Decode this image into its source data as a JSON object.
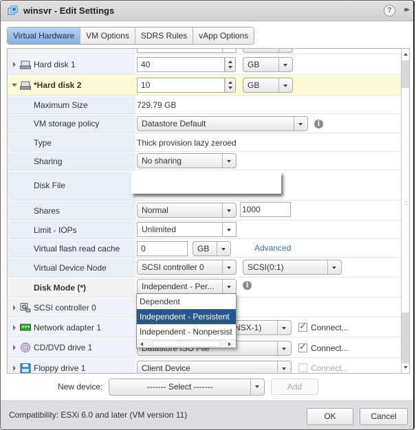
{
  "window": {
    "title": "winsvr - Edit Settings",
    "help_label": "?",
    "expand_label": "▸▸"
  },
  "tabs": [
    {
      "label": "Virtual Hardware",
      "active": true
    },
    {
      "label": "VM Options",
      "active": false
    },
    {
      "label": "SDRS Rules",
      "active": false
    },
    {
      "label": "vApp Options",
      "active": false
    }
  ],
  "hardware": {
    "hard_disk_1": {
      "label": "Hard disk 1",
      "size": "40",
      "unit": "GB"
    },
    "hard_disk_2": {
      "label": "*Hard disk 2",
      "size": "10",
      "unit": "GB",
      "max_size_label": "Maximum Size",
      "max_size_value": "729.79 GB",
      "storage_policy_label": "VM storage policy",
      "storage_policy_value": "Datastore Default",
      "type_label": "Type",
      "type_value": "Thick provision lazy zeroed",
      "sharing_label": "Sharing",
      "sharing_value": "No sharing",
      "disk_file_label": "Disk File",
      "shares_label": "Shares",
      "shares_value": "Normal",
      "shares_number": "1000",
      "limit_label": "Limit - IOPs",
      "limit_value": "Unlimited",
      "flash_label": "Virtual flash read cache",
      "flash_value": "0",
      "flash_unit": "GB",
      "advanced_link": "Advanced",
      "vdn_label": "Virtual Device Node",
      "vdn_controller": "SCSI controller 0",
      "vdn_slot": "SCSI(0:1)",
      "disk_mode_label": "Disk Mode (*)",
      "disk_mode_value": "Independent - Per..."
    },
    "scsi_controller": {
      "label": "SCSI controller 0"
    },
    "network_adapter": {
      "label": "Network adapter 1",
      "value": "NSX-1)",
      "connect_label": "Connect...",
      "connected": true
    },
    "cd_dvd": {
      "label": "CD/DVD drive 1",
      "value": "Datastore ISO File",
      "connect_label": "Connect...",
      "connected": true
    },
    "floppy": {
      "label": "Floppy drive 1",
      "value": "Client Device",
      "connect_label": "Connect...",
      "connected": false
    }
  },
  "disk_mode_dropdown": {
    "options": [
      "Dependent",
      "Independent - Persistent",
      "Independent - Nonpersist"
    ],
    "selected_index": 1
  },
  "new_device": {
    "label": "New device:",
    "select_value": "------- Select -------",
    "add_label": "Add"
  },
  "footer": {
    "compatibility": "Compatibility: ESXi 6.0 and later (VM version 11)",
    "ok_label": "OK",
    "cancel_label": "Cancel"
  }
}
